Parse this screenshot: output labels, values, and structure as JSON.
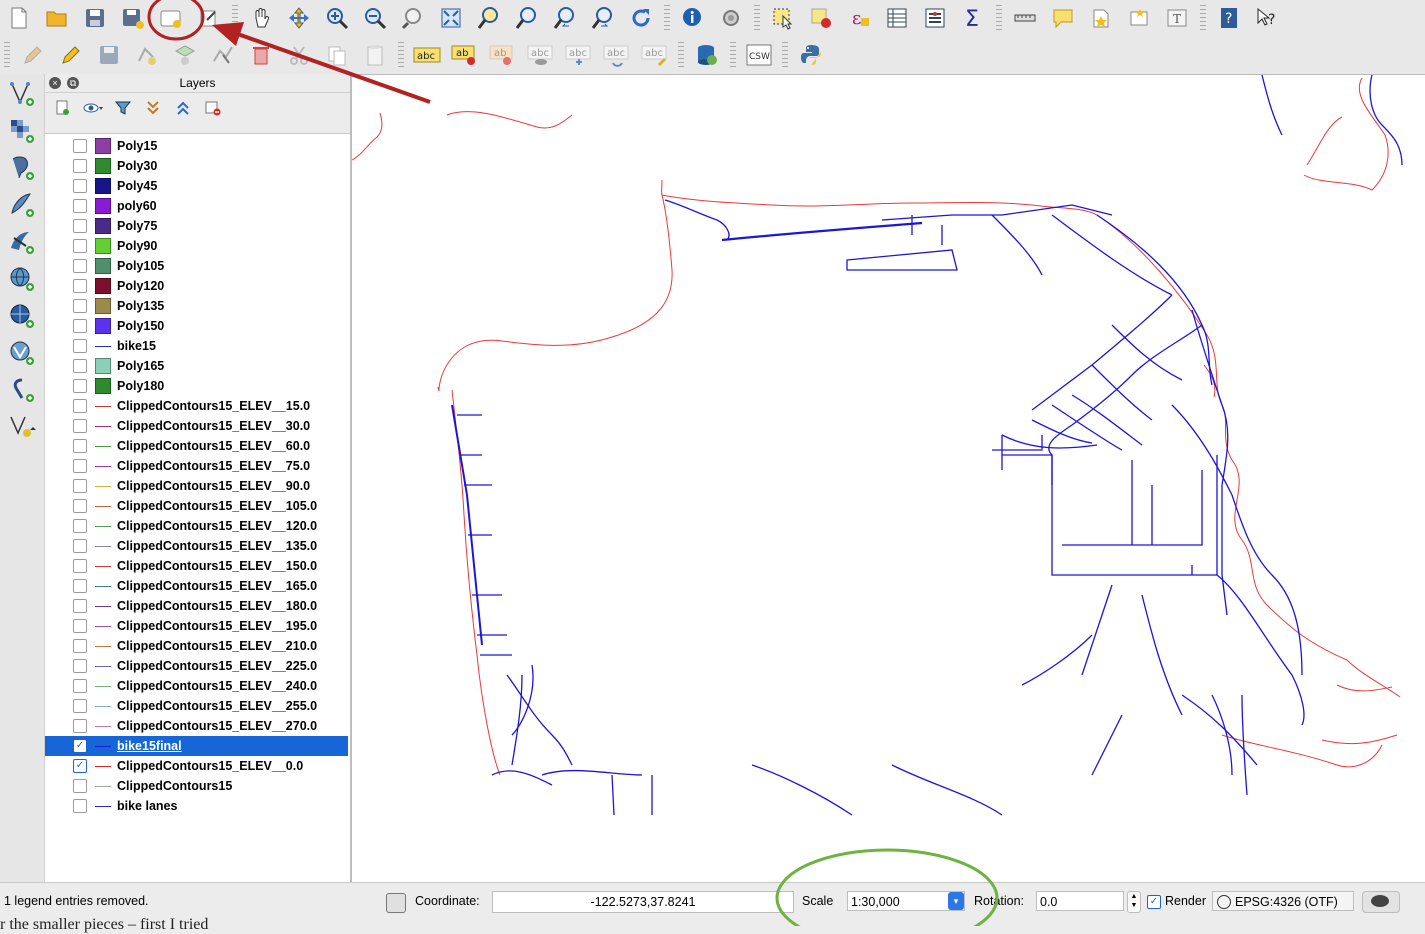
{
  "toolbar_top": {
    "items": [
      "new-project-icon",
      "open-project-icon",
      "save-project-icon",
      "save-as-icon",
      "new-print-composer-icon",
      "composer-manager-icon",
      "pan-icon",
      "pan-to-selection-icon",
      "zoom-in-icon",
      "zoom-out-icon",
      "zoom-actual-icon",
      "zoom-full-icon",
      "zoom-to-selection-icon",
      "zoom-to-layer-icon",
      "zoom-last-icon",
      "zoom-next-icon",
      "refresh-icon",
      "identify-icon",
      "action-icon",
      "select-features-icon",
      "deselect-icon",
      "expression-icon",
      "attribute-table-icon",
      "field-calculator-icon",
      "statistics-icon",
      "measure-icon",
      "map-tips-icon",
      "new-bookmark-icon",
      "show-bookmarks-icon",
      "text-annotation-icon",
      "help-icon",
      "whats-this-icon"
    ]
  },
  "toolbar_second": {
    "items": [
      "toggle-editing-icon",
      "current-edits-icon",
      "save-edits-icon",
      "add-feature-icon",
      "move-feature-icon",
      "node-tool-icon",
      "delete-selected-icon",
      "cut-features-icon",
      "copy-features-icon",
      "paste-features-icon",
      "label-tool-icon",
      "pin-labels-icon",
      "highlight-pinned-icon",
      "show-hide-labels-icon",
      "move-label-icon",
      "rotate-label-icon",
      "change-label-icon",
      "db-manager-icon",
      "csw-icon",
      "python-console-icon"
    ],
    "csw_label": "CSW",
    "abc_label": "abc",
    "ab_label": "ab"
  },
  "left_toolbar": {
    "items": [
      "add-vector-layer-icon",
      "add-raster-layer-icon",
      "add-postgis-layer-icon",
      "add-spatialite-layer-icon",
      "add-mssql-layer-icon",
      "add-wms-layer-icon",
      "add-wcs-layer-icon",
      "add-wfs-layer-icon",
      "add-delimited-text-icon",
      "new-shapefile-icon"
    ]
  },
  "layers_panel": {
    "title": "Layers",
    "layers": [
      {
        "name": "Poly15",
        "type": "fill",
        "color": "#8e3ea6",
        "checked": false
      },
      {
        "name": "Poly30",
        "type": "fill",
        "color": "#2e8b2e",
        "checked": false
      },
      {
        "name": "Poly45",
        "type": "fill",
        "color": "#16168a",
        "checked": false
      },
      {
        "name": "poly60",
        "type": "fill",
        "color": "#8a1ad4",
        "checked": false
      },
      {
        "name": "Poly75",
        "type": "fill",
        "color": "#4b2a8c",
        "checked": false
      },
      {
        "name": "Poly90",
        "type": "fill",
        "color": "#62cf32",
        "checked": false
      },
      {
        "name": "Poly105",
        "type": "fill",
        "color": "#4f8f6a",
        "checked": false
      },
      {
        "name": "Poly120",
        "type": "fill",
        "color": "#7e0f2c",
        "checked": false
      },
      {
        "name": "Poly135",
        "type": "fill",
        "color": "#9b8a4a",
        "checked": false
      },
      {
        "name": "Poly150",
        "type": "fill",
        "color": "#5a32f0",
        "checked": false
      },
      {
        "name": "bike15",
        "type": "line",
        "color": "#2a2ad0",
        "checked": false
      },
      {
        "name": "Poly165",
        "type": "fill",
        "color": "#8ad0b4",
        "checked": false
      },
      {
        "name": "Poly180",
        "type": "fill",
        "color": "#2d8a2d",
        "checked": false
      },
      {
        "name": "ClippedContours15_ELEV__15.0",
        "type": "line",
        "color": "#c23a3a",
        "checked": false
      },
      {
        "name": "ClippedContours15_ELEV__30.0",
        "type": "line",
        "color": "#b0306a",
        "checked": false
      },
      {
        "name": "ClippedContours15_ELEV__60.0",
        "type": "line",
        "color": "#4a9a4a",
        "checked": false
      },
      {
        "name": "ClippedContours15_ELEV__75.0",
        "type": "line",
        "color": "#a23aa2",
        "checked": false
      },
      {
        "name": "ClippedContours15_ELEV__90.0",
        "type": "line",
        "color": "#d4b43a",
        "checked": false
      },
      {
        "name": "ClippedContours15_ELEV__105.0",
        "type": "line",
        "color": "#c06a3a",
        "checked": false
      },
      {
        "name": "ClippedContours15_ELEV__120.0",
        "type": "line",
        "color": "#5a9a5a",
        "checked": false
      },
      {
        "name": "ClippedContours15_ELEV__135.0",
        "type": "line",
        "color": "#8a8aa0",
        "checked": false
      },
      {
        "name": "ClippedContours15_ELEV__150.0",
        "type": "line",
        "color": "#d43a3a",
        "checked": false
      },
      {
        "name": "ClippedContours15_ELEV__165.0",
        "type": "line",
        "color": "#3a8a7a",
        "checked": false
      },
      {
        "name": "ClippedContours15_ELEV__180.0",
        "type": "line",
        "color": "#7a3a8a",
        "checked": false
      },
      {
        "name": "ClippedContours15_ELEV__195.0",
        "type": "line",
        "color": "#9a5ab0",
        "checked": false
      },
      {
        "name": "ClippedContours15_ELEV__210.0",
        "type": "line",
        "color": "#c07a3a",
        "checked": false
      },
      {
        "name": "ClippedContours15_ELEV__225.0",
        "type": "line",
        "color": "#6a6ab0",
        "checked": false
      },
      {
        "name": "ClippedContours15_ELEV__240.0",
        "type": "line",
        "color": "#7ab07a",
        "checked": false
      },
      {
        "name": "ClippedContours15_ELEV__255.0",
        "type": "line",
        "color": "#8ab0c0",
        "checked": false
      },
      {
        "name": "ClippedContours15_ELEV__270.0",
        "type": "line",
        "color": "#c07a9a",
        "checked": false
      },
      {
        "name": "bike15final",
        "type": "line",
        "color": "#1a1ad0",
        "checked": true,
        "selected": true
      },
      {
        "name": "ClippedContours15_ELEV__0.0",
        "type": "line",
        "color": "#d42a2a",
        "checked": true
      },
      {
        "name": "ClippedContours15",
        "type": "line",
        "color": "#9ab0a0",
        "checked": false
      },
      {
        "name": "bike lanes",
        "type": "line",
        "color": "#2a2ac8",
        "checked": false
      }
    ]
  },
  "map": {
    "bike_color": "#1c16d6",
    "contour_color": "#e83a3a"
  },
  "statusbar": {
    "message": "1 legend entries removed.",
    "coordinate_label": "Coordinate:",
    "coordinate_value": "-122.5273,37.8241",
    "scale_label": "Scale",
    "scale_value": "1:30,000",
    "rotation_label": "Rotation:",
    "rotation_value": "0.0",
    "render_label": "Render",
    "render_checked": true,
    "crs_label": "EPSG:4326 (OTF)"
  },
  "below_text": "r the smaller pieces – first I tried",
  "annotations": {
    "circle_color": "#b22222",
    "arrow_color": "#b22222",
    "scale_circle_color": "#6db33f"
  }
}
